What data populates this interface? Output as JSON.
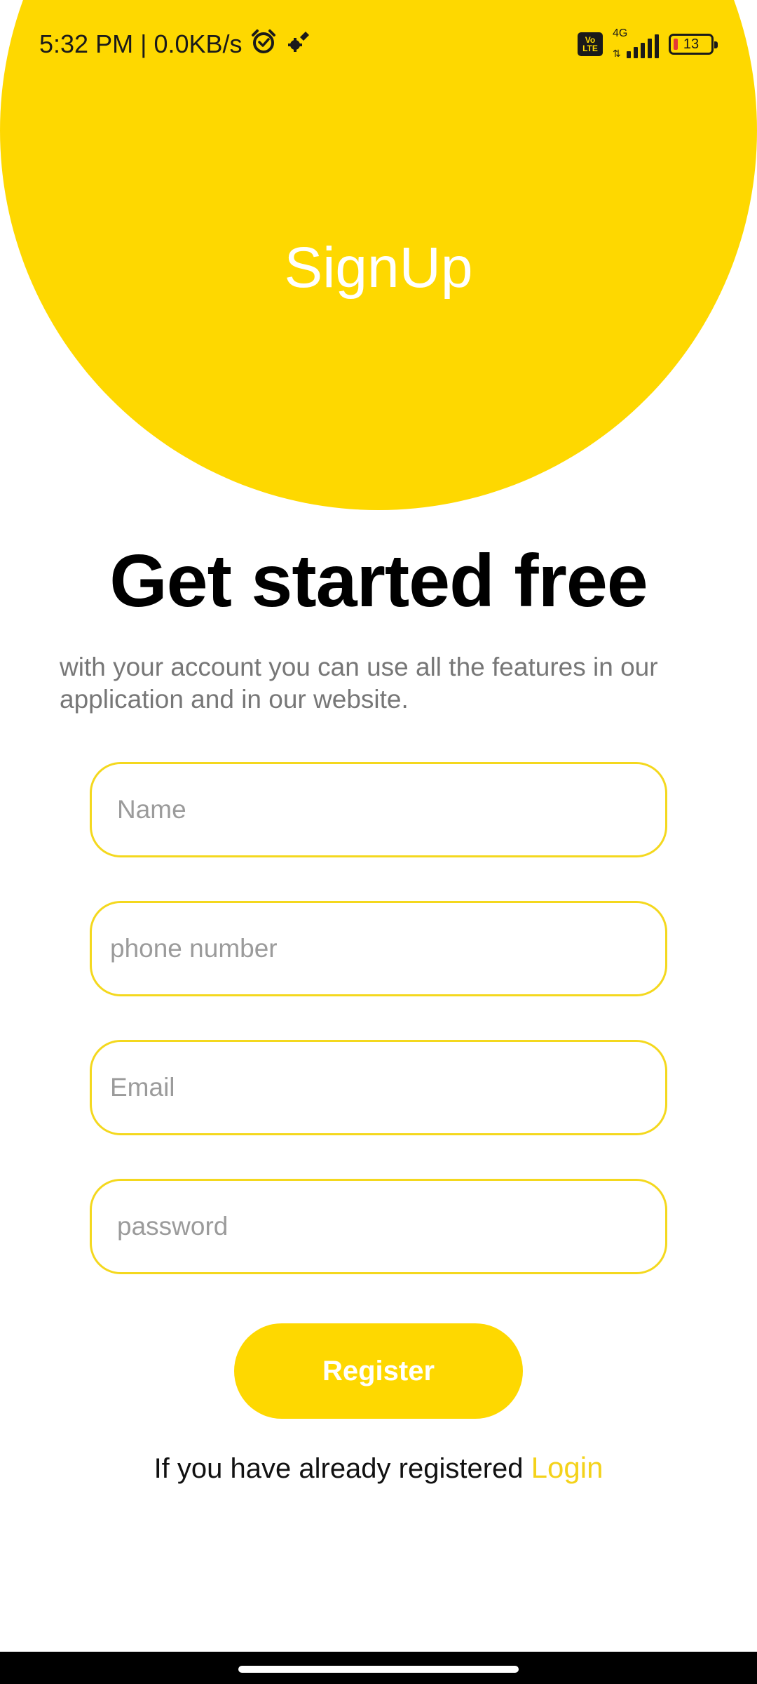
{
  "status_bar": {
    "time": "5:32 PM",
    "separator": "|",
    "speed": "0.0KB/s",
    "alarm_icon": "alarm-clock-icon",
    "settings_icon": "gear-icon",
    "volte_top": "Vo",
    "volte_bottom": "LTE",
    "network_type": "4G",
    "data_arrows": "⇅",
    "battery_level": "13"
  },
  "header": {
    "title": "SignUp"
  },
  "main": {
    "headline": "Get started free",
    "description": "with your account you can use all the features in our application and in our website."
  },
  "form": {
    "name_placeholder": "Name",
    "phone_placeholder": "phone number",
    "email_placeholder": "Email",
    "password_placeholder": "password",
    "register_label": "Register"
  },
  "footer": {
    "prompt": "If you have already registered",
    "login_label": "Login"
  },
  "colors": {
    "accent": "#FED800",
    "field_border": "#F4D81E",
    "login_link": "#F4D21A"
  }
}
